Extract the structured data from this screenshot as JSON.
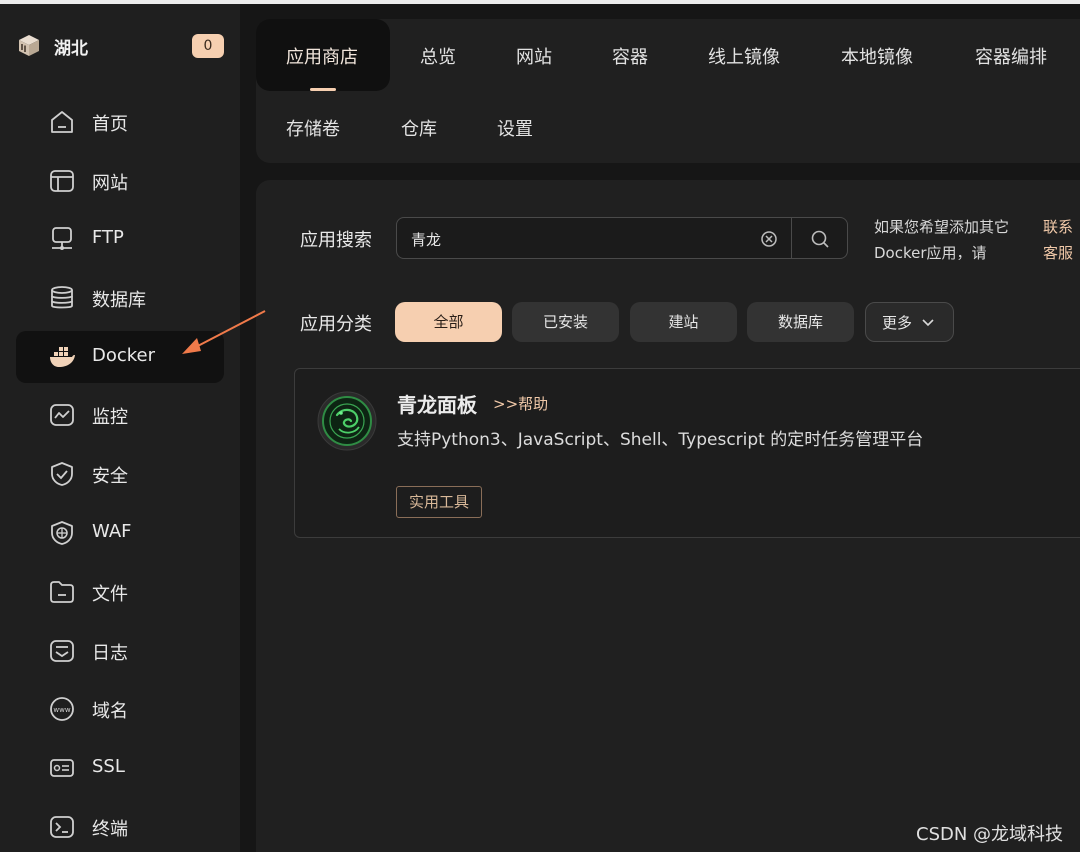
{
  "brand": {
    "name": "湖北",
    "badge": "0"
  },
  "sidebar": {
    "items": [
      {
        "label": "首页",
        "icon": "home-icon"
      },
      {
        "label": "网站",
        "icon": "website-icon"
      },
      {
        "label": "FTP",
        "icon": "ftp-icon"
      },
      {
        "label": "数据库",
        "icon": "database-icon"
      },
      {
        "label": "Docker",
        "icon": "docker-icon",
        "active": true
      },
      {
        "label": "监控",
        "icon": "monitor-icon"
      },
      {
        "label": "安全",
        "icon": "shield-icon"
      },
      {
        "label": "WAF",
        "icon": "waf-icon"
      },
      {
        "label": "文件",
        "icon": "folder-icon"
      },
      {
        "label": "日志",
        "icon": "log-icon"
      },
      {
        "label": "域名",
        "icon": "domain-icon"
      },
      {
        "label": "SSL",
        "icon": "ssl-icon"
      },
      {
        "label": "终端",
        "icon": "terminal-icon"
      }
    ]
  },
  "tabs": {
    "row1": [
      "应用商店",
      "总览",
      "网站",
      "容器",
      "线上镜像",
      "本地镜像",
      "容器编排"
    ],
    "row2": [
      "存储卷",
      "仓库",
      "设置"
    ],
    "active": "应用商店"
  },
  "search": {
    "label": "应用搜索",
    "value": "青龙",
    "hint": "如果您希望添加其它Docker应用，请",
    "hint_link": "联系客服"
  },
  "categories": {
    "label": "应用分类",
    "items": [
      "全部",
      "已安装",
      "建站",
      "数据库"
    ],
    "more": "更多",
    "active": "全部"
  },
  "app": {
    "name": "青龙面板",
    "help": ">>帮助",
    "description": "支持Python3、JavaScript、Shell、Typescript 的定时任务管理平台",
    "tag": "实用工具"
  },
  "watermark": "CSDN @龙域科技",
  "colors": {
    "accent": "#f6cfb0",
    "annotation_arrow": "#f07a4a"
  }
}
